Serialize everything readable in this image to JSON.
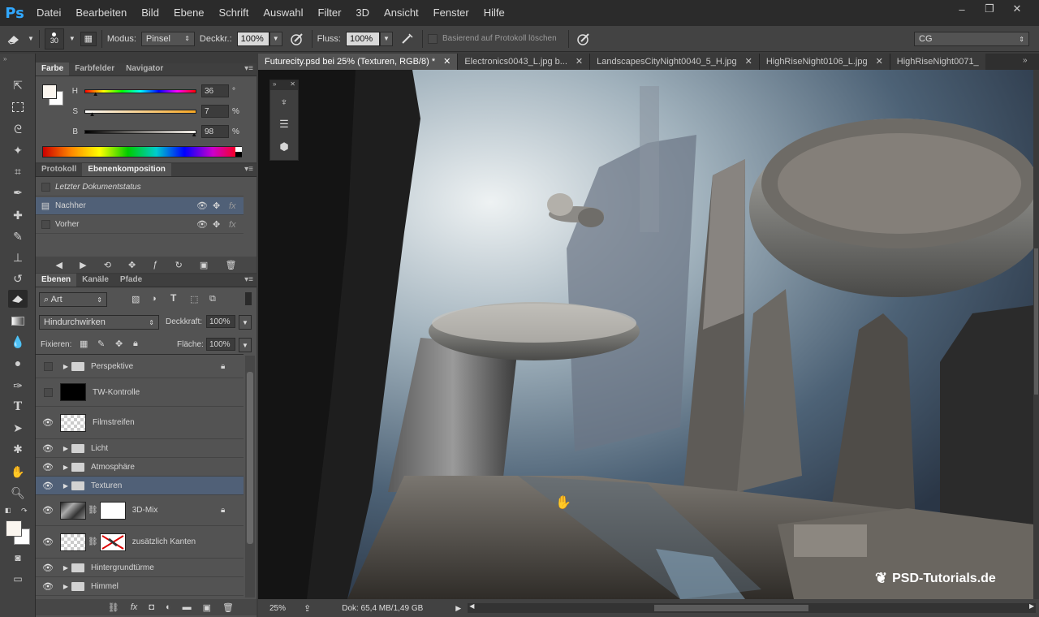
{
  "app": {
    "logo": "Ps"
  },
  "menu": [
    "Datei",
    "Bearbeiten",
    "Bild",
    "Ebene",
    "Schrift",
    "Auswahl",
    "Filter",
    "3D",
    "Ansicht",
    "Fenster",
    "Hilfe"
  ],
  "window_controls": {
    "minimize": "–",
    "restore": "❐",
    "close": "✕"
  },
  "options": {
    "brush_size": "30",
    "mode_label": "Modus:",
    "mode_value": "Pinsel",
    "opacity_label": "Deckkr.:",
    "opacity_value": "100%",
    "flow_label": "Fluss:",
    "flow_value": "100%",
    "history_label": "Basierend auf Protokoll löschen",
    "workspace": "CG"
  },
  "color_panel": {
    "tabs": [
      "Farbe",
      "Farbfelder",
      "Navigator"
    ],
    "h_label": "H",
    "h_value": "36",
    "h_unit": "°",
    "s_label": "S",
    "s_value": "7",
    "s_unit": "%",
    "b_label": "B",
    "b_value": "98",
    "b_unit": "%",
    "h_level": 0.1,
    "s_level": 0.07,
    "b_level": 0.98
  },
  "comp_panel": {
    "tabs": [
      "Protokoll",
      "Ebenenkomposition"
    ],
    "rows": [
      {
        "label": "Letzter Dokumentstatus"
      },
      {
        "label": "Nachher"
      },
      {
        "label": "Vorher"
      }
    ]
  },
  "layers_panel": {
    "tabs": [
      "Ebenen",
      "Kanäle",
      "Pfade"
    ],
    "filter": "Art",
    "blend": "Hindurchwirken",
    "opacity_label": "Deckkraft:",
    "opacity_value": "100%",
    "lock_label": "Fixieren:",
    "fill_label": "Fläche:",
    "fill_value": "100%",
    "layers": [
      {
        "name": "Perspektive"
      },
      {
        "name": "TW-Kontrolle"
      },
      {
        "name": "Filmstreifen"
      },
      {
        "name": "Licht"
      },
      {
        "name": "Atmosphäre"
      },
      {
        "name": "Texturen"
      },
      {
        "name": "3D-Mix"
      },
      {
        "name": "zusätzlich Kanten"
      },
      {
        "name": "Hintergrundtürme"
      },
      {
        "name": "Himmel"
      }
    ]
  },
  "doc_tabs": [
    "Futurecity.psd bei 25% (Texturen, RGB/8) *",
    "Electronics0043_L.jpg b...",
    "LandscapesCityNight0040_5_H.jpg",
    "HighRiseNight0106_L.jpg",
    "HighRiseNight0071_"
  ],
  "status": {
    "zoom": "25%",
    "doc": "Dok: 65,4 MB/1,49 GB"
  },
  "watermark": "PSD-Tutorials.de"
}
